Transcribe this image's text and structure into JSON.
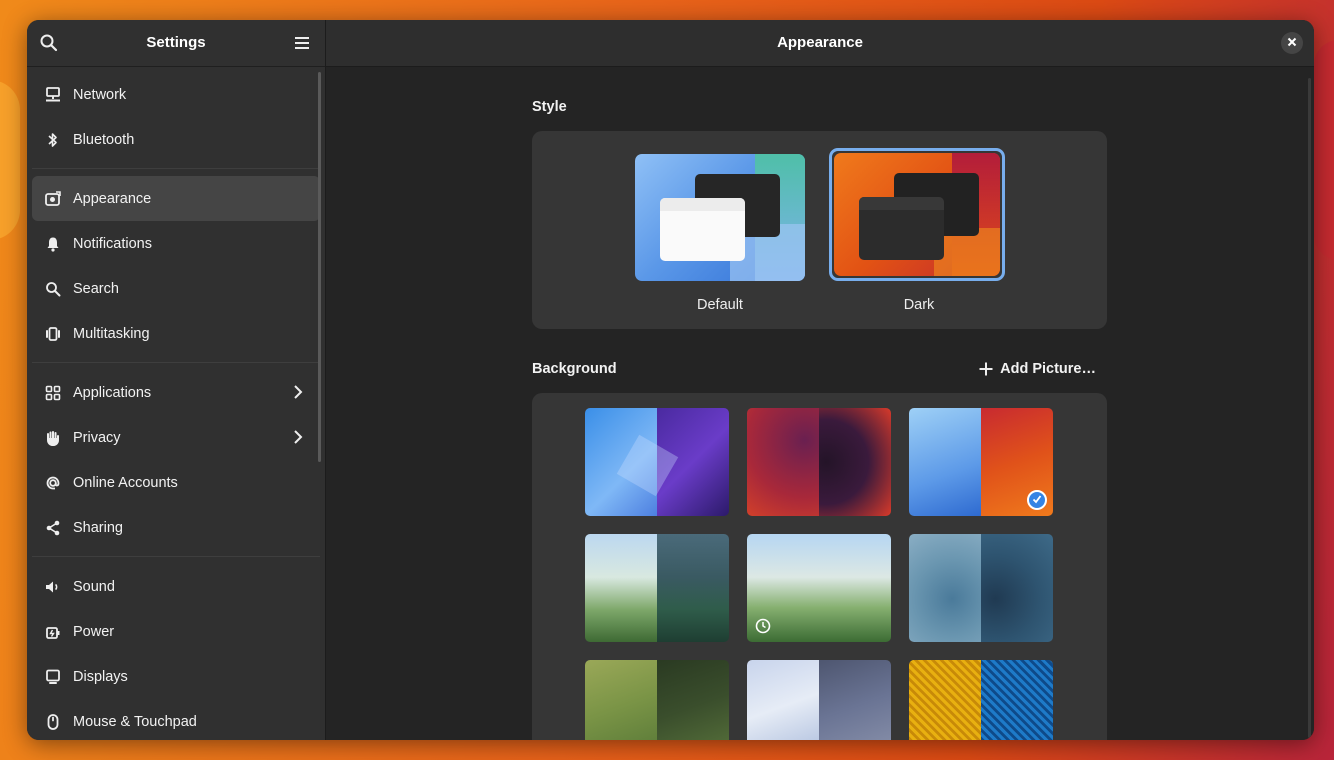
{
  "sidebar": {
    "title": "Settings",
    "items": [
      {
        "label": "Network",
        "icon": "network-icon"
      },
      {
        "label": "Bluetooth",
        "icon": "bluetooth-icon"
      },
      {
        "label": "Appearance",
        "icon": "appearance-icon",
        "active": true
      },
      {
        "label": "Notifications",
        "icon": "bell-icon"
      },
      {
        "label": "Search",
        "icon": "search-icon"
      },
      {
        "label": "Multitasking",
        "icon": "multitasking-icon"
      },
      {
        "label": "Applications",
        "icon": "grid-icon",
        "has_chevron": true
      },
      {
        "label": "Privacy",
        "icon": "hand-icon",
        "has_chevron": true
      },
      {
        "label": "Online Accounts",
        "icon": "at-icon"
      },
      {
        "label": "Sharing",
        "icon": "share-icon"
      },
      {
        "label": "Sound",
        "icon": "speaker-icon"
      },
      {
        "label": "Power",
        "icon": "power-icon"
      },
      {
        "label": "Displays",
        "icon": "display-icon"
      },
      {
        "label": "Mouse & Touchpad",
        "icon": "mouse-icon"
      }
    ]
  },
  "main": {
    "title": "Appearance",
    "style_section": {
      "title": "Style",
      "options": [
        {
          "label": "Default",
          "selected": false
        },
        {
          "label": "Dark",
          "selected": true
        }
      ]
    },
    "background_section": {
      "title": "Background",
      "add_picture_label": "Add Picture…",
      "selected_index": 2,
      "timed_index": 4
    }
  },
  "colors": {
    "accent": "#78aeed",
    "window_bg": "#242424",
    "sidebar_bg": "#303030",
    "active_item": "#454545"
  }
}
